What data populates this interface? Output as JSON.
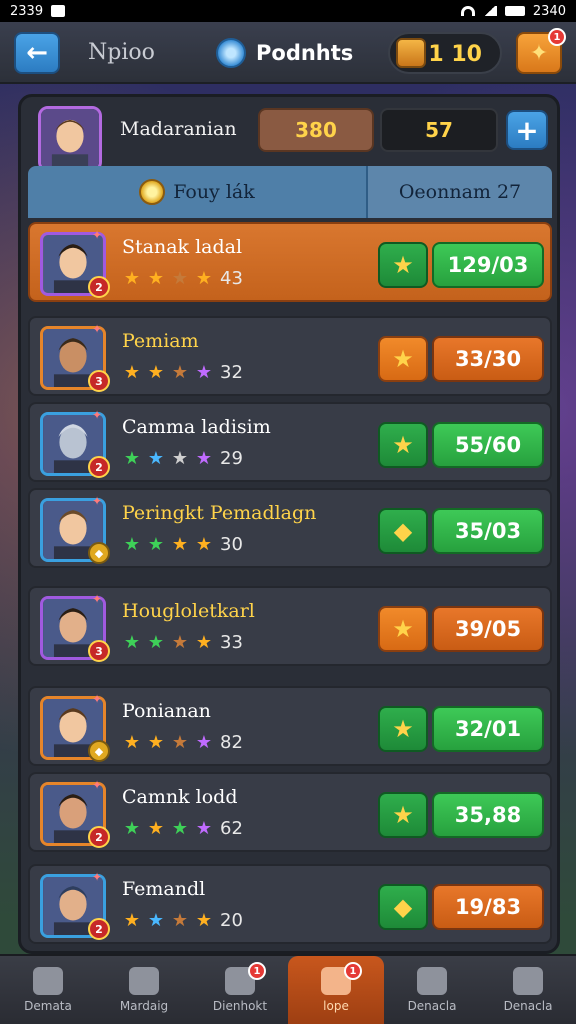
{
  "status_bar": {
    "time": "2339",
    "right_text": "2340"
  },
  "top_bar": {
    "title": "Npioo",
    "points_label": "Podnhts",
    "coins": "1 10",
    "gift_badge": "1"
  },
  "header": {
    "name": "Madaranian",
    "stat1": "380",
    "stat2": "57",
    "tabs": [
      "Fouy lák",
      "Oeonnam 27"
    ]
  },
  "rows": [
    {
      "name": "Stanak ladal",
      "stars": [
        "gold",
        "gold",
        "brown",
        "gold"
      ],
      "level": "43",
      "action_icon": "★",
      "score": "129/03",
      "badge": "2",
      "action_color": "green",
      "score_color": "green",
      "highlight": true
    },
    {
      "name": "Pemiam",
      "stars": [
        "gold",
        "gold",
        "brown",
        "purple"
      ],
      "level": "32",
      "action_icon": "★",
      "score": "33/30",
      "badge": "3",
      "action_color": "orange",
      "score_color": "orange"
    },
    {
      "name": "Camma ladisim",
      "stars": [
        "green",
        "blue",
        "grey",
        "purple"
      ],
      "level": "29",
      "action_icon": "★",
      "score": "55/60",
      "badge": "2",
      "action_color": "green",
      "score_color": "green"
    },
    {
      "name": "Peringkt Pemadlagn",
      "stars": [
        "green",
        "green",
        "gold",
        "gold"
      ],
      "level": "30",
      "action_icon": "◆",
      "score": "35/03",
      "badge": "",
      "action_color": "green",
      "score_color": "green"
    },
    {
      "name": "Hougloletkarl",
      "stars": [
        "green",
        "green",
        "brown",
        "gold"
      ],
      "level": "33",
      "action_icon": "★",
      "score": "39/05",
      "badge": "3",
      "action_color": "orange",
      "score_color": "orange"
    },
    {
      "name": "Ponianan",
      "stars": [
        "gold",
        "gold",
        "brown",
        "purple"
      ],
      "level": "82",
      "action_icon": "★",
      "score": "32/01",
      "badge": "",
      "action_color": "green",
      "score_color": "green"
    },
    {
      "name": "Camnk lodd",
      "stars": [
        "green",
        "gold",
        "green",
        "purple"
      ],
      "level": "62",
      "action_icon": "★",
      "score": "35,88",
      "badge": "2",
      "action_color": "green",
      "score_color": "green"
    },
    {
      "name": "Femandl",
      "stars": [
        "gold",
        "blue",
        "brown",
        "gold"
      ],
      "level": "20",
      "action_icon": "◆",
      "score": "19/83",
      "badge": "2",
      "action_color": "green",
      "score_color": "orange"
    }
  ],
  "bottom_nav": [
    {
      "label": "Demata",
      "badge": ""
    },
    {
      "label": "Mardaig",
      "badge": ""
    },
    {
      "label": "Dienhokt",
      "badge": "1"
    },
    {
      "label": "lope",
      "badge": "1",
      "active": true
    },
    {
      "label": "Denacla",
      "badge": ""
    },
    {
      "label": "Denacla",
      "badge": ""
    }
  ]
}
